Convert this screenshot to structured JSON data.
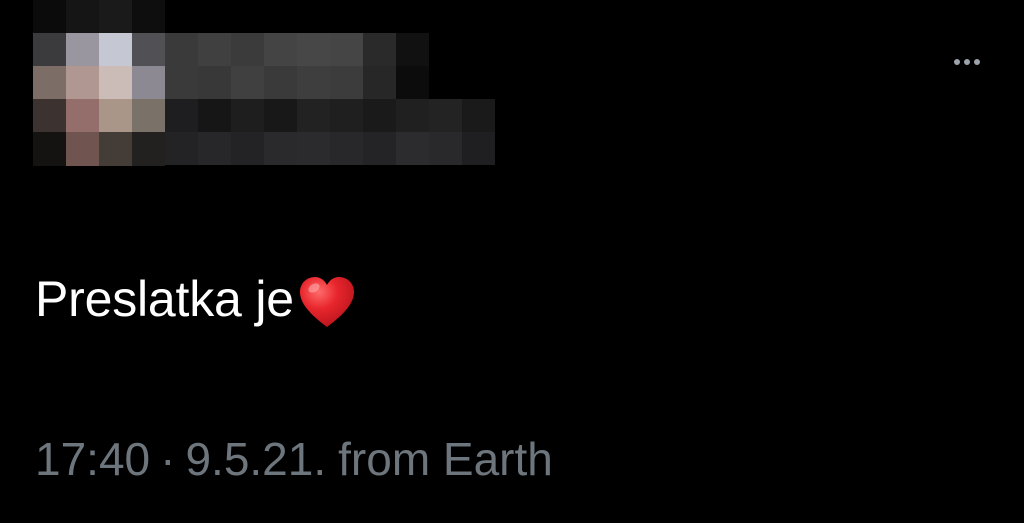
{
  "tweet": {
    "text": "Preslatka je",
    "emoji": "heart-emoji",
    "time": "17:40",
    "separator": "·",
    "date": "9.5.21.",
    "source": "from Earth"
  },
  "header": {
    "more_icon": "more-horizontal-icon"
  },
  "colors": {
    "background": "#000000",
    "text": "#ffffff",
    "meta": "#6e767d",
    "heart": "#e0242b"
  }
}
